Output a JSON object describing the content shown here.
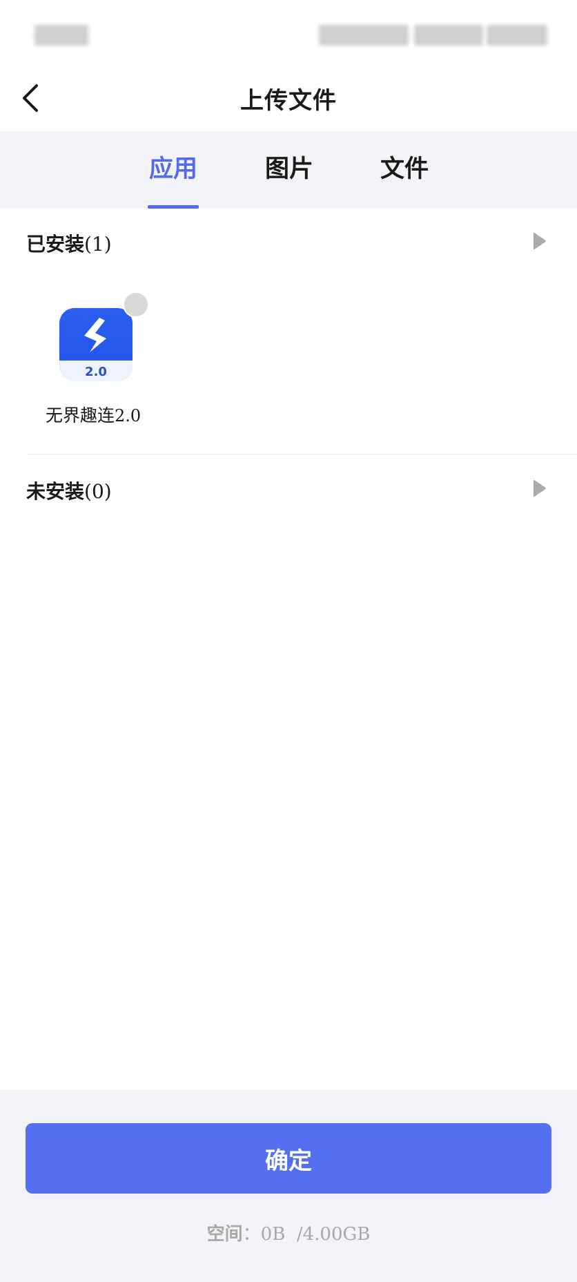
{
  "header": {
    "title": "上传文件",
    "back_icon": "chevron-left-icon"
  },
  "tabs": [
    {
      "label": "应用",
      "active": true
    },
    {
      "label": "图片",
      "active": false
    },
    {
      "label": "文件",
      "active": false
    }
  ],
  "colors": {
    "accent": "#5468ee",
    "button": "#5470f0",
    "tab_bg": "#f3f4f8"
  },
  "installed": {
    "title": "已安装",
    "count": "(1)",
    "apps": [
      {
        "name_main": "无界趣连",
        "name_version": "2.0",
        "icon_text": "2.0",
        "selected": false
      }
    ]
  },
  "uninstalled": {
    "title": "未安装",
    "count": "(0)"
  },
  "footer": {
    "confirm_label": "确定",
    "storage_label": "空间",
    "storage_separator": "：",
    "used": "0B",
    "total": "/4.00GB"
  }
}
